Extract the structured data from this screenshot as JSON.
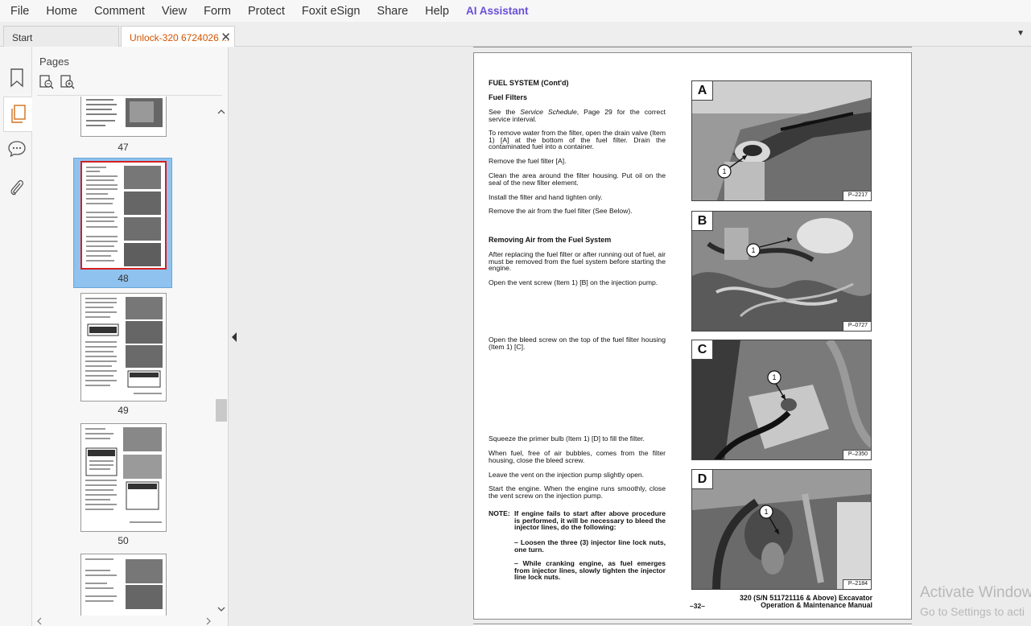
{
  "menu": {
    "items": [
      "File",
      "Home",
      "Comment",
      "View",
      "Form",
      "Protect",
      "Foxit eSign",
      "Share",
      "Help"
    ],
    "ai_label": "AI Assistant"
  },
  "tabs": {
    "start_label": "Start",
    "doc_label": "Unlock-320 6724026 ...",
    "close_glyph": "✕",
    "dropdown_glyph": "▼"
  },
  "pages_panel": {
    "title": "Pages",
    "thumbnails": [
      {
        "label": "47"
      },
      {
        "label": "48"
      },
      {
        "label": "49"
      },
      {
        "label": "50"
      }
    ]
  },
  "document": {
    "section_title": "FUEL SYSTEM (Cont'd)",
    "subsection_filters": "Fuel Filters",
    "para_schedule_pre": "See the ",
    "para_schedule_em": "Service Schedule",
    "para_schedule_post": ", Page 29 for the correct service interval.",
    "para_water": "To remove water from the filter, open the drain valve (Item 1) [A] at the bottom of the fuel filter. Drain the contaminated fuel into a container.",
    "para_remove": "Remove the fuel filter [A].",
    "para_clean": "Clean the area around the filter housing. Put oil on the seal of the new filter element.",
    "para_install": "Install the filter and hand tighten only.",
    "para_air": "Remove the air from the fuel filter (See Below).",
    "subsection_air": "Removing Air from the Fuel System",
    "para_after": "After replacing the fuel filter or after running out of fuel, air must be removed from the fuel system before starting the engine.",
    "para_vent": "Open the vent screw (Item 1) [B] on the injection pump.",
    "para_bleed": "Open the bleed screw on the top of the fuel filter housing (Item 1) [C].",
    "para_squeeze": "Squeeze the primer bulb (Item 1) [D] to fill the filter.",
    "para_when": "When fuel, free of air bubbles, comes from the filter housing, close the bleed screw.",
    "para_leave": "Leave the vent on the injection pump slightly open.",
    "para_start": "Start the engine. When the engine runs smoothly, close the vent screw on the injection pump.",
    "note_label": "NOTE:",
    "note_text": "If engine fails to start after above procedure is performed, it will be necessary to bleed the injector lines, do the following:",
    "note_b1": "– Loosen the three (3) injector line lock nuts, one turn.",
    "note_b2": "– While cranking engine, as fuel emerges from injector lines, slowly tighten the injector line lock nuts.",
    "page_number": "–32–",
    "footer_line1": "320 (S/N 511721116 & Above) Excavator",
    "footer_line2": "Operation & Maintenance Manual",
    "photos": [
      {
        "letter": "A",
        "code": "P–2217",
        "callout": "1"
      },
      {
        "letter": "B",
        "code": "P–0727",
        "callout": "1"
      },
      {
        "letter": "C",
        "code": "P–2350",
        "callout": "1"
      },
      {
        "letter": "D",
        "code": "P–2184",
        "callout": "1"
      }
    ]
  },
  "watermark": {
    "line1": "Activate Window",
    "line2": "Go to Settings to acti"
  }
}
